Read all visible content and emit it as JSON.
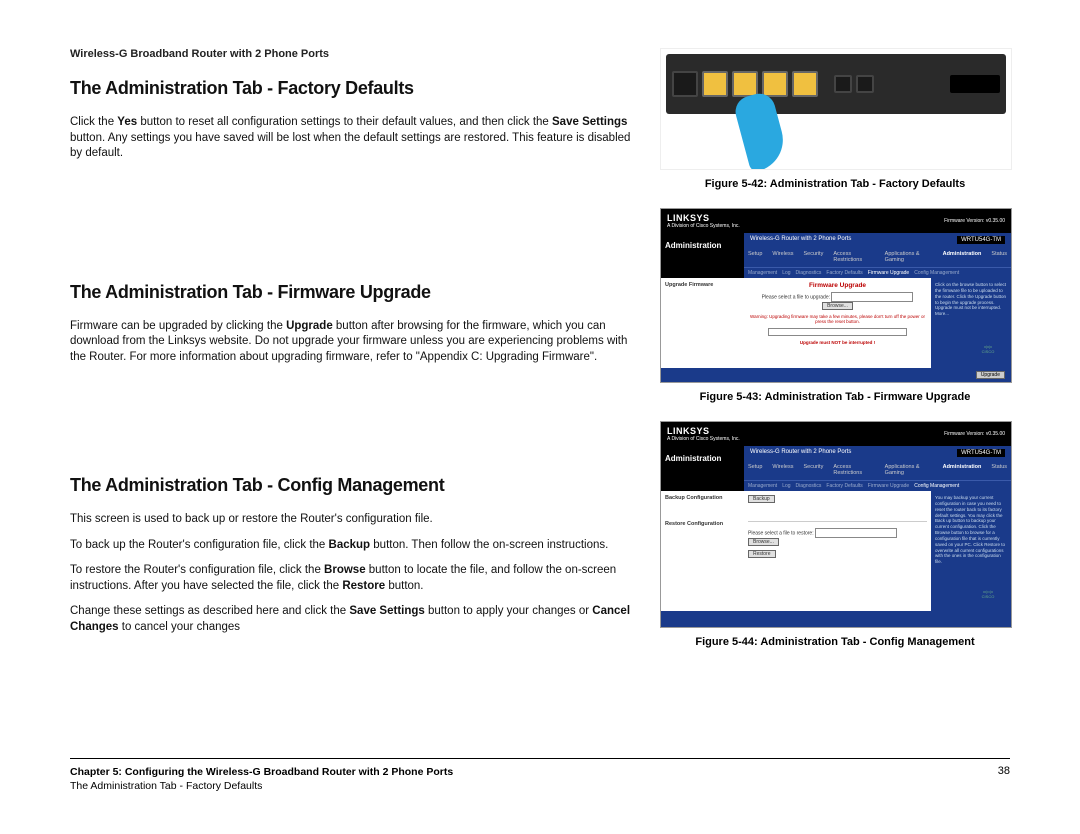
{
  "header": "Wireless-G Broadband Router with 2 Phone Ports",
  "sections": {
    "s1": {
      "title": "The Administration Tab - Factory Defaults",
      "p1a": "Click the ",
      "p1b_bold": "Yes",
      "p1c": " button to reset all configuration settings to their default values, and then click the ",
      "p1d_bold": "Save Settings",
      "p1e": " button. Any settings you have saved will be lost when the default settings are restored. This feature is disabled by default."
    },
    "s2": {
      "title": "The Administration Tab - Firmware Upgrade",
      "p1a": "Firmware can be upgraded by clicking the ",
      "p1b_bold": "Upgrade",
      "p1c": " button after browsing for the firmware, which you can download from the Linksys website. Do not upgrade your firmware unless you are experiencing problems with the Router. For more information about upgrading firmware, refer to \"Appendix C: Upgrading Firmware\"."
    },
    "s3": {
      "title": "The Administration Tab - Config Management",
      "p1": "This screen is used to back up or restore the Router's configuration file.",
      "p2a": "To back up the Router's configuration file, click the ",
      "p2b_bold": "Backup",
      "p2c": " button. Then follow the on-screen instructions.",
      "p3a": "To restore the Router's configuration file, click the ",
      "p3b_bold": "Browse",
      "p3c": " button to locate the file, and follow the on-screen instructions. After you have selected the file, click the ",
      "p3d_bold": "Restore",
      "p3e": " button.",
      "p4a": "Change these settings as described here and click the ",
      "p4b_bold": "Save Settings",
      "p4c": " button to apply your changes or ",
      "p4d_bold": "Cancel Changes",
      "p4e": " to cancel your changes"
    }
  },
  "captions": {
    "c1": "Figure 5-42: Administration Tab - Factory Defaults",
    "c2": "Figure 5-43: Administration Tab - Firmware Upgrade",
    "c3": "Figure 5-44: Administration Tab - Config Management"
  },
  "screenshot": {
    "brand": "LINKSYS",
    "brand_sub": "A Division of Cisco Systems, Inc.",
    "firmware_ver": "Firmware Version: v0.35.00",
    "product": "Wireless-G Router with 2 Phone Ports",
    "model": "WRTU54G-TM",
    "tab_main": "Administration",
    "tabs": [
      "Setup",
      "Wireless",
      "Security",
      "Access Restrictions",
      "Applications & Gaming",
      "Administration",
      "Status"
    ],
    "subtabs_fw": [
      "Management",
      "Log",
      "Diagnostics",
      "Factory Defaults",
      "Firmware Upgrade",
      "Config Management"
    ],
    "fw": {
      "side": "Upgrade Firmware",
      "title": "Firmware Upgrade",
      "label": "Please select a file to upgrade:",
      "browse": "Browse...",
      "warn1": "Warning: Upgrading firmware may take a few minutes, please don't turn off the power or press the reset button.",
      "warn2": "Upgrade must NOT be interrupted !",
      "btn": "Upgrade",
      "help": "Click on the browse button to select the firmware file to be uploaded to the router.\n\nClick the Upgrade button to begin the upgrade process. Upgrade must not be interrupted.\n\nMore..."
    },
    "cfg": {
      "side1": "Backup Configuration",
      "side2": "Restore Configuration",
      "backup": "Backup",
      "label": "Please select a file to restore:",
      "browse": "Browse...",
      "restore": "Restore",
      "help": "You may backup your current configuration in case you need to reset the router back to its factory default settings.\n\nYou may click the Back up button to backup your current configuration.\n\nClick the Browse button to browse for a configuration file that is currently saved on your PC.\n\nClick Restore to overwrite all current configurations with the ones in the configuration file."
    }
  },
  "footer": {
    "chapter": "Chapter 5: Configuring the Wireless-G Broadband Router with 2 Phone Ports",
    "subtitle": "The Administration Tab - Factory Defaults",
    "page": "38"
  }
}
